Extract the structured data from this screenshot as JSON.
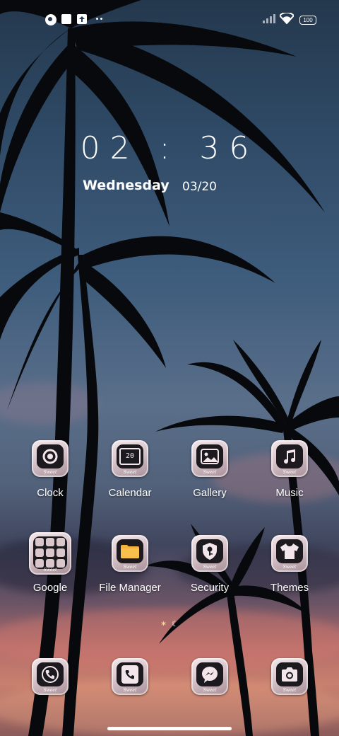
{
  "status_bar": {
    "battery": "100"
  },
  "clock": {
    "time": "02 : 36",
    "day": "Wednesday",
    "date": "03/20"
  },
  "apps": [
    {
      "label": "Clock",
      "icon": "clock-icon"
    },
    {
      "label": "Calendar",
      "icon": "calendar-icon",
      "badge": "20"
    },
    {
      "label": "Gallery",
      "icon": "gallery-icon"
    },
    {
      "label": "Music",
      "icon": "music-icon"
    },
    {
      "label": "Google",
      "icon": "google-folder-icon"
    },
    {
      "label": "File Manager",
      "icon": "folder-icon"
    },
    {
      "label": "Security",
      "icon": "security-icon"
    },
    {
      "label": "Themes",
      "icon": "tshirt-icon"
    }
  ],
  "dock": [
    {
      "icon": "phone-icon"
    },
    {
      "icon": "contacts-icon"
    },
    {
      "icon": "messenger-icon"
    },
    {
      "icon": "camera-icon"
    }
  ],
  "icon_caption": "Sweet",
  "colors": {
    "icon_tile": "#e6d6db",
    "icon_inner": "#1c1a1f",
    "text": "#ffffff"
  }
}
